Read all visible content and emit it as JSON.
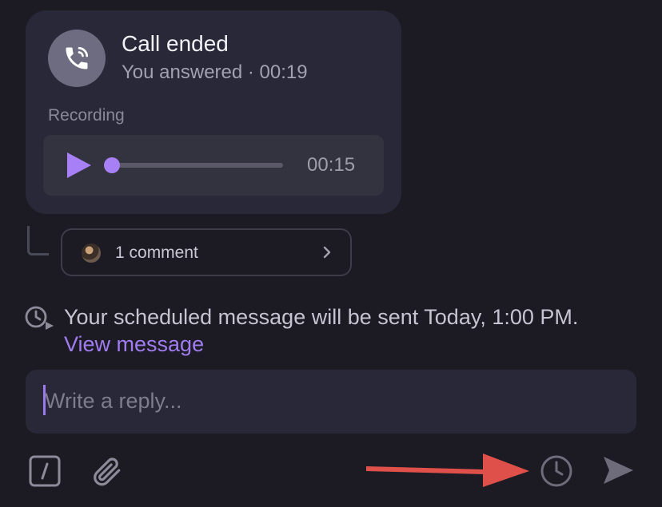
{
  "call": {
    "title": "Call ended",
    "subtitle": "You answered · 00:19",
    "recording_label": "Recording",
    "duration": "00:15",
    "progress": 0.02
  },
  "comments": {
    "label": "1 comment"
  },
  "scheduled": {
    "text": "Your scheduled message will be sent Today, 1:00 PM.",
    "link": "View message"
  },
  "reply": {
    "placeholder": "Write a reply..."
  },
  "toolbar": {
    "icons": [
      "slash-command-icon",
      "paperclip-icon",
      "clock-icon",
      "send-icon"
    ]
  },
  "colors": {
    "background": "#1c1b24",
    "card": "#292838",
    "accent": "#a07cf0",
    "annotation_arrow": "#e0504a"
  }
}
